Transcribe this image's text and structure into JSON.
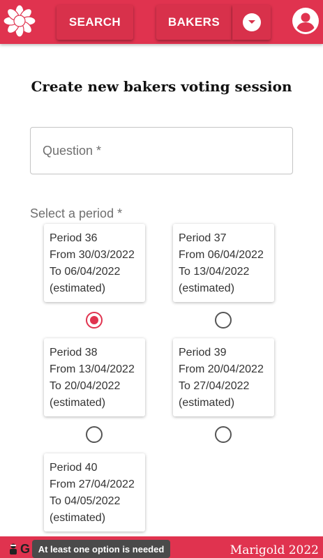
{
  "navbar": {
    "search_label": "SEARCH",
    "bakers_label": "BAKERS",
    "accent_color": "#e0334f"
  },
  "page_title": "Create new bakers voting session",
  "question_field": {
    "placeholder": "Question *",
    "value": ""
  },
  "period_label": "Select a period *",
  "periods": [
    {
      "name": "Period 36",
      "from": "From 30/03/2022",
      "to": "To 06/04/2022",
      "note": "(estimated)",
      "selected": true
    },
    {
      "name": "Period 37",
      "from": "From 06/04/2022",
      "to": "To 13/04/2022",
      "note": "(estimated)",
      "selected": false
    },
    {
      "name": "Period 38",
      "from": "From 13/04/2022",
      "to": "To 20/04/2022",
      "note": "(estimated)",
      "selected": false
    },
    {
      "name": "Period 39",
      "from": "From 20/04/2022",
      "to": "To 27/04/2022",
      "note": "(estimated)",
      "selected": false
    },
    {
      "name": "Period 40",
      "from": "From 27/04/2022",
      "to": "To 04/05/2022",
      "note": "(estimated)",
      "selected": false
    }
  ],
  "footer": {
    "letter": "G",
    "brand": "Marigold 2022"
  },
  "snackbar": {
    "message": "At least one option is needed"
  }
}
